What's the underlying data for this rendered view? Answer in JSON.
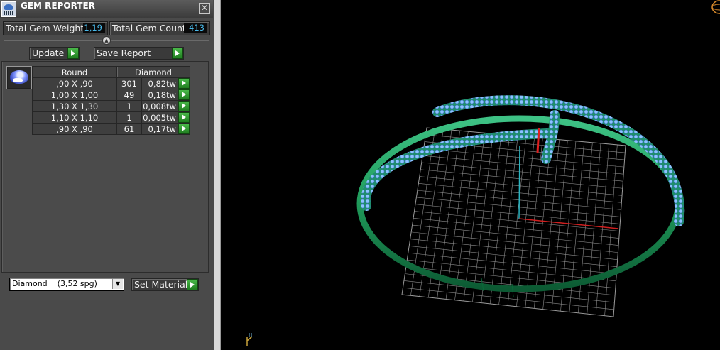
{
  "window": {
    "title": "GEM REPORTER",
    "close_glyph": "✕"
  },
  "totals": {
    "weight_label": "Total Gem Weight",
    "weight_value": "1,19",
    "count_label": "Total Gem Count",
    "count_value": "413"
  },
  "buttons": {
    "update": "Update",
    "save_report": "Save Report",
    "set_material": "Set Material"
  },
  "table": {
    "headers": [
      "Round",
      "Diamond"
    ],
    "rows": [
      {
        "size": ",90 X ,90",
        "count": "301",
        "weight": "0,82tw"
      },
      {
        "size": "1,00 X 1,00",
        "count": "49",
        "weight": "0,18tw"
      },
      {
        "size": "1,30 X 1,30",
        "count": "1",
        "weight": "0,008tw"
      },
      {
        "size": "1,10 X 1,10",
        "count": "1",
        "weight": "0,005tw"
      },
      {
        "size": ",90 X ,90",
        "count": "61",
        "weight": "0,17tw"
      }
    ]
  },
  "material": {
    "selected": "Diamond    (3,52 spg)",
    "dropdown_icon": "▼"
  },
  "icons": {
    "app": "gem-reporter-icon",
    "gem": "round-gem-icon",
    "go": "green-arrow-icon",
    "collapse": "collapse-icon",
    "axis_triad": "axis-triad-icon",
    "orbit": "orbit-gizmo-icon"
  },
  "colors": {
    "panel_bg": "#4a4a4a",
    "value_text": "#48b8e8",
    "go_button": "#2fa02f",
    "viewport_bg": "#000000",
    "ring": "#1f9a5a",
    "gems": "#7fb8ff"
  }
}
